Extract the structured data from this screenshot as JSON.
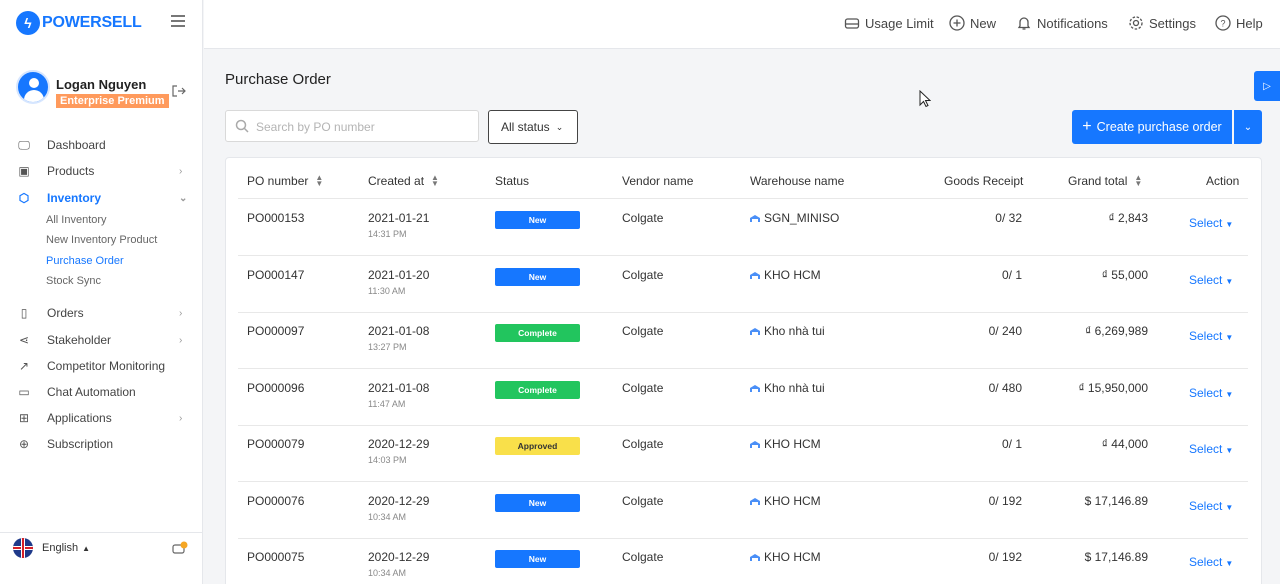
{
  "brand": {
    "name_part1": "POWER",
    "name_part2": "SELL"
  },
  "user": {
    "name": "Logan Nguyen",
    "plan": "Enterprise Premium"
  },
  "nav": {
    "dashboard": "Dashboard",
    "products": "Products",
    "inventory": "Inventory",
    "sub": {
      "all_inventory": "All Inventory",
      "new_inventory_product": "New Inventory Product",
      "purchase_order": "Purchase Order",
      "stock_sync": "Stock Sync"
    },
    "orders": "Orders",
    "stakeholder": "Stakeholder",
    "competitor_monitoring": "Competitor Monitoring",
    "chat_automation": "Chat Automation",
    "applications": "Applications",
    "subscription": "Subscription"
  },
  "language": {
    "label": "English"
  },
  "topbar": {
    "usage_limit": "Usage Limit",
    "new": "New",
    "notifications": "Notifications",
    "settings": "Settings",
    "help": "Help"
  },
  "page": {
    "title": "Purchase Order",
    "search_placeholder": "Search by PO number",
    "status_filter": "All status",
    "create_label": "Create purchase order"
  },
  "table": {
    "headers": {
      "po_number": "PO number",
      "created_at": "Created at",
      "status": "Status",
      "vendor_name": "Vendor name",
      "warehouse_name": "Warehouse name",
      "goods_receipt": "Goods Receipt",
      "grand_total": "Grand total",
      "action": "Action"
    },
    "action_label": "Select",
    "rows": [
      {
        "po": "PO000153",
        "date": "2021-01-21",
        "time": "14:31 PM",
        "status": "New",
        "vendor": "Colgate",
        "warehouse": "SGN_MINISO",
        "receipt": "0/ 32",
        "total": "₫ 2,843"
      },
      {
        "po": "PO000147",
        "date": "2021-01-20",
        "time": "11:30 AM",
        "status": "New",
        "vendor": "Colgate",
        "warehouse": "KHO HCM",
        "receipt": "0/ 1",
        "total": "₫ 55,000"
      },
      {
        "po": "PO000097",
        "date": "2021-01-08",
        "time": "13:27 PM",
        "status": "Complete",
        "vendor": "Colgate",
        "warehouse": "Kho nhà tui",
        "receipt": "0/ 240",
        "total": "₫ 6,269,989"
      },
      {
        "po": "PO000096",
        "date": "2021-01-08",
        "time": "11:47 AM",
        "status": "Complete",
        "vendor": "Colgate",
        "warehouse": "Kho nhà tui",
        "receipt": "0/ 480",
        "total": "₫ 15,950,000"
      },
      {
        "po": "PO000079",
        "date": "2020-12-29",
        "time": "14:03 PM",
        "status": "Approved",
        "vendor": "Colgate",
        "warehouse": "KHO HCM",
        "receipt": "0/ 1",
        "total": "₫ 44,000"
      },
      {
        "po": "PO000076",
        "date": "2020-12-29",
        "time": "10:34 AM",
        "status": "New",
        "vendor": "Colgate",
        "warehouse": "KHO HCM",
        "receipt": "0/ 192",
        "total": "$ 17,146.89"
      },
      {
        "po": "PO000075",
        "date": "2020-12-29",
        "time": "10:34 AM",
        "status": "New",
        "vendor": "Colgate",
        "warehouse": "KHO HCM",
        "receipt": "0/ 192",
        "total": "$ 17,146.89"
      }
    ]
  },
  "colors": {
    "accent": "#1677ff",
    "new": "#1677ff",
    "complete": "#22c55e",
    "approved": "#f9e04a",
    "plan_badge": "#ff9a5c"
  }
}
